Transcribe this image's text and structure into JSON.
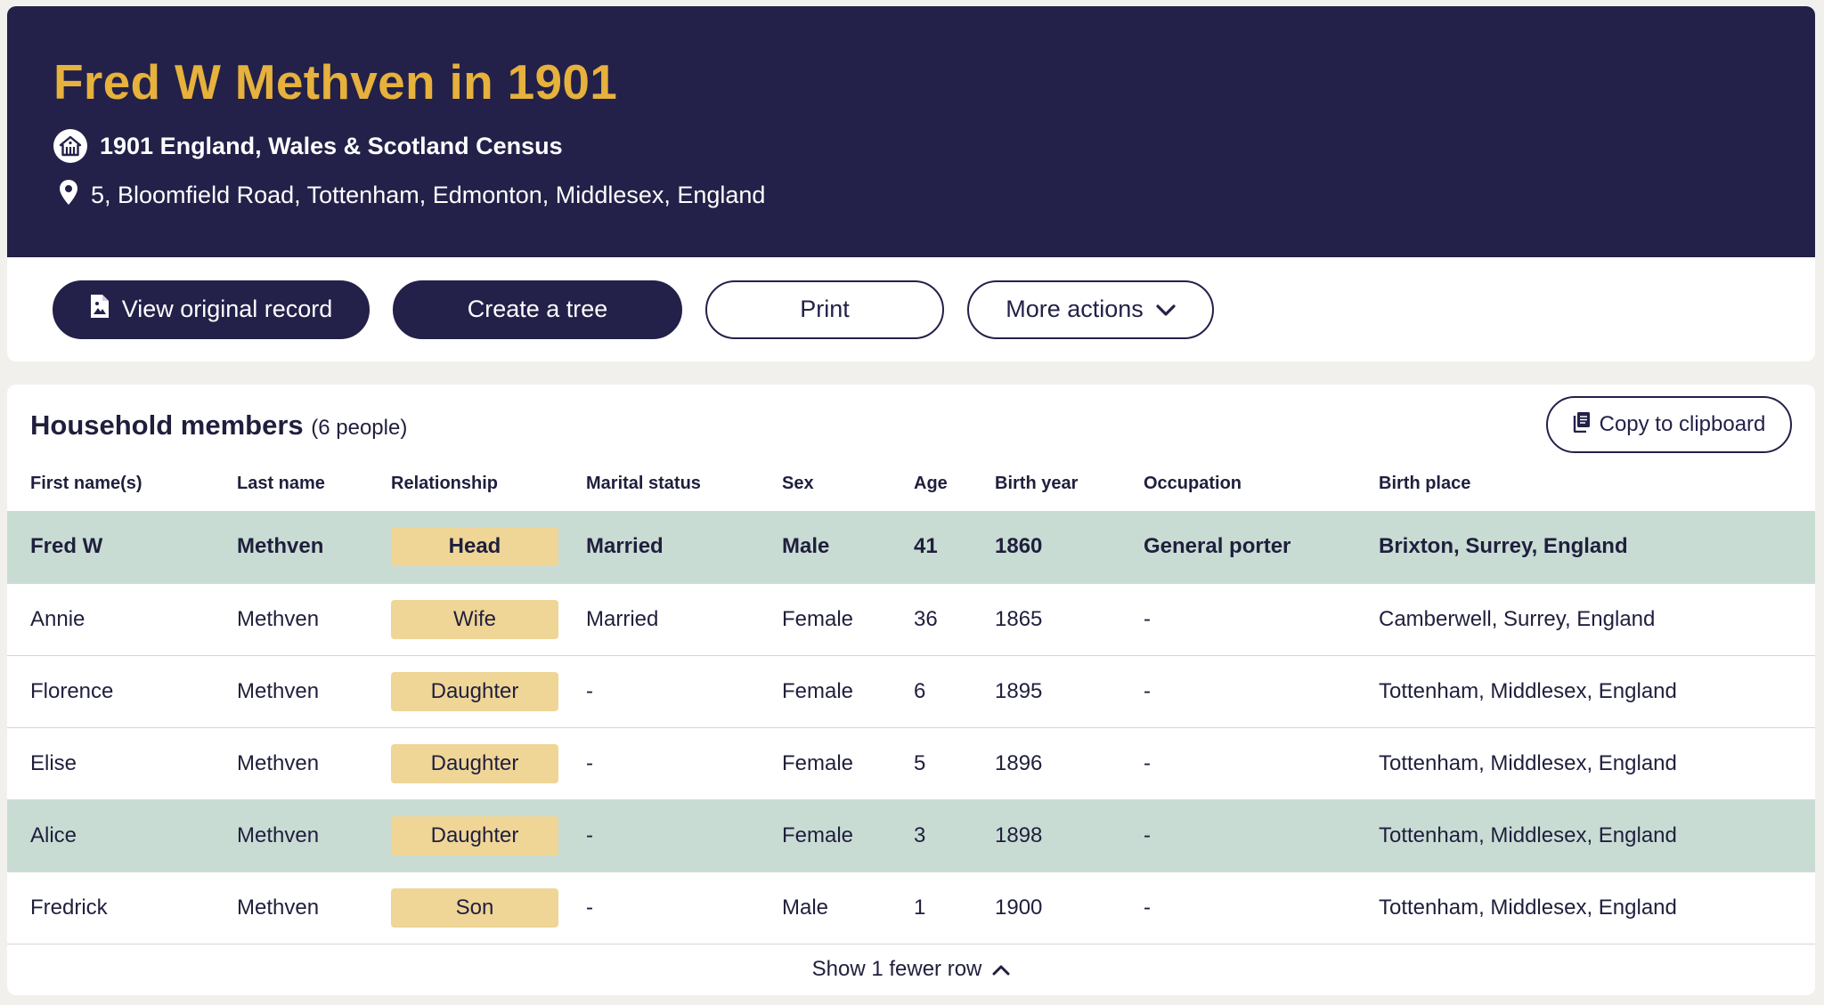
{
  "header": {
    "title": "Fred W Methven in 1901",
    "collection": "1901 England, Wales & Scotland Census",
    "address": "5, Bloomfield Road, Tottenham, Edmonton, Middlesex, England"
  },
  "actions": {
    "view_original": "View original record",
    "create_tree": "Create a tree",
    "print": "Print",
    "more_actions": "More actions"
  },
  "household": {
    "title": "Household members",
    "count": "(6 people)",
    "copy_label": "Copy to clipboard",
    "columns": [
      "First name(s)",
      "Last name",
      "Relationship",
      "Marital status",
      "Sex",
      "Age",
      "Birth year",
      "Occupation",
      "Birth place"
    ],
    "rows": [
      {
        "first": "Fred W",
        "last": "Methven",
        "relationship": "Head",
        "marital": "Married",
        "sex": "Male",
        "age": "41",
        "birth_year": "1860",
        "occupation": "General porter",
        "birth_place": "Brixton, Surrey, England"
      },
      {
        "first": "Annie",
        "last": "Methven",
        "relationship": "Wife",
        "marital": "Married",
        "sex": "Female",
        "age": "36",
        "birth_year": "1865",
        "occupation": "-",
        "birth_place": "Camberwell, Surrey, England"
      },
      {
        "first": "Florence",
        "last": "Methven",
        "relationship": "Daughter",
        "marital": "-",
        "sex": "Female",
        "age": "6",
        "birth_year": "1895",
        "occupation": "-",
        "birth_place": "Tottenham, Middlesex, England"
      },
      {
        "first": "Elise",
        "last": "Methven",
        "relationship": "Daughter",
        "marital": "-",
        "sex": "Female",
        "age": "5",
        "birth_year": "1896",
        "occupation": "-",
        "birth_place": "Tottenham, Middlesex, England"
      },
      {
        "first": "Alice",
        "last": "Methven",
        "relationship": "Daughter",
        "marital": "-",
        "sex": "Female",
        "age": "3",
        "birth_year": "1898",
        "occupation": "-",
        "birth_place": "Tottenham, Middlesex, England"
      },
      {
        "first": "Fredrick",
        "last": "Methven",
        "relationship": "Son",
        "marital": "-",
        "sex": "Male",
        "age": "1",
        "birth_year": "1900",
        "occupation": "-",
        "birth_place": "Tottenham, Middlesex, England"
      }
    ],
    "show_fewer": "Show 1 fewer row"
  },
  "colors": {
    "navy": "#232149",
    "gold_title": "#e6b13c",
    "row_highlight": "#c9dcd4",
    "relationship_chip": "#efd596"
  },
  "icons": {
    "collection": "census-house-icon",
    "location": "map-pin-icon",
    "view_original": "document-image-icon",
    "more_actions": "chevron-down-icon",
    "copy": "clipboard-icon",
    "show_fewer": "chevron-up-icon"
  }
}
